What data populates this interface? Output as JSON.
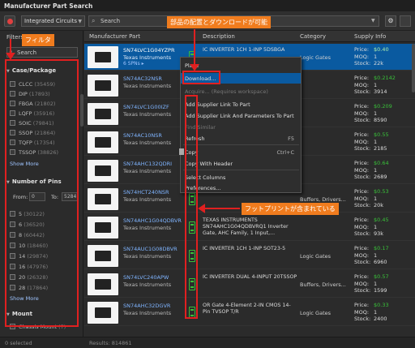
{
  "window": {
    "title": "Manufacturer Part Search"
  },
  "toolbar": {
    "category": "Integrated Circuits",
    "search_placeholder": "Search"
  },
  "filters": {
    "label": "Filters",
    "search_placeholder": "Search",
    "groups": [
      {
        "title": "Case/Package",
        "items": [
          {
            "name": "CLCC",
            "count": "(35459)"
          },
          {
            "name": "DIP",
            "count": "(17893)"
          },
          {
            "name": "FBGA",
            "count": "(21802)"
          },
          {
            "name": "LQFP",
            "count": "(35916)"
          },
          {
            "name": "SOIC",
            "count": "(79841)"
          },
          {
            "name": "SSOP",
            "count": "(21864)"
          },
          {
            "name": "TQFP",
            "count": "(17354)"
          },
          {
            "name": "TSSOP",
            "count": "(38826)"
          }
        ],
        "show_more": "Show More"
      },
      {
        "title": "Number of Pins",
        "from_label": "From:",
        "from_value": "0",
        "to_label": "To:",
        "to_value": "5284",
        "items": [
          {
            "name": "5",
            "count": "(30122)"
          },
          {
            "name": "6",
            "count": "(36520)"
          },
          {
            "name": "8",
            "count": "(60442)"
          },
          {
            "name": "10",
            "count": "(18460)"
          },
          {
            "name": "14",
            "count": "(29874)"
          },
          {
            "name": "16",
            "count": "(47976)"
          },
          {
            "name": "20",
            "count": "(26328)"
          },
          {
            "name": "28",
            "count": "(17864)"
          }
        ],
        "show_more": "Show More"
      },
      {
        "title": "Mount",
        "items": [
          {
            "name": "Chassis Mount",
            "count": "(7)"
          }
        ]
      }
    ]
  },
  "columns": [
    "Manufacturer Part",
    "Description",
    "Category",
    "Supply Info"
  ],
  "rows": [
    {
      "part": "SN74LVC1G04YZPR",
      "mfr": "Texas Instruments",
      "extra": "6 SPNs ▸",
      "desc": "IC INVERTER 1CH 1-INP 5DSBGA",
      "cat": "Logic Gates",
      "price": "$0.40",
      "moq": "1",
      "stock": "22k"
    },
    {
      "part": "SN74AC32NSR",
      "mfr": "Texas Instruments",
      "extra": "",
      "desc": "",
      "cat": "",
      "price": "$0.2142",
      "moq": "1",
      "stock": "3914"
    },
    {
      "part": "SN74LVC1G00IZF",
      "mfr": "Texas Instruments",
      "extra": "",
      "desc": "",
      "cat": "",
      "price": "$0.209",
      "moq": "1",
      "stock": "8590"
    },
    {
      "part": "SN74AC10NSR",
      "mfr": "Texas Instruments",
      "extra": "",
      "desc": "",
      "cat": "",
      "price": "$0.55",
      "moq": "1",
      "stock": "2185"
    },
    {
      "part": "SN74AHC132QDRI",
      "mfr": "Texas Instruments",
      "extra": "",
      "desc": "",
      "cat": "",
      "price": "$0.64",
      "moq": "1",
      "stock": "2689"
    },
    {
      "part": "SN74HCT240NSR",
      "mfr": "Texas Instruments",
      "extra": "",
      "desc": "",
      "cat": "Buffers, Drivers...",
      "price": "$0.53",
      "moq": "1",
      "stock": "20k"
    },
    {
      "part": "SN74AHC1G04QDBVR",
      "mfr": "Texas Instruments",
      "extra": "",
      "desc": "TEXAS INSTRUMENTS SN74AHC1G04QDBVRQ1 Inverter Gate, AHC Family, 1 Input,...",
      "cat": "",
      "price": "$0.45",
      "moq": "1",
      "stock": "93k"
    },
    {
      "part": "SN74AUC1G08DBVR",
      "mfr": "Texas Instruments",
      "extra": "",
      "desc": "IC INVERTER 1CH 1-INP SOT23-5",
      "cat": "Logic Gates",
      "price": "$0.17",
      "moq": "1",
      "stock": "6960"
    },
    {
      "part": "SN74LVC240APW",
      "mfr": "Texas Instruments",
      "extra": "",
      "desc": "IC INVERTER DUAL 4-INPUT 20TSSOP",
      "cat": "Buffers, Drivers...",
      "price": "$0.57",
      "moq": "1",
      "stock": "1599"
    },
    {
      "part": "SN74AHC32DGVR",
      "mfr": "Texas Instruments",
      "extra": "",
      "desc": "OR Gate 4-Element 2-IN CMOS 14-Pin TVSOP T/R",
      "cat": "Logic Gates",
      "price": "$0.33",
      "moq": "1",
      "stock": "2400"
    }
  ],
  "supply_labels": {
    "price": "Price:",
    "moq": "MOQ:",
    "stock": "Stock:"
  },
  "context_menu": {
    "items": [
      "Place",
      "Download...",
      "Acquire... (Requires workspace)",
      "Add Supplier Link To Part",
      "Add Supplier Link And Parameters To Part",
      "Find Similar",
      "Refresh",
      "Copy",
      "Copy With Header",
      "Select Columns",
      "Preferences..."
    ],
    "refresh_shortcut": "F5",
    "copy_shortcut": "Ctrl+C"
  },
  "annotations": {
    "filter": "フィルタ",
    "top": "部品の配置とダウンロードが可能",
    "footprint": "フットプリントが含まれている"
  },
  "status": {
    "selected": "0 selected",
    "results": "Results: 814861"
  },
  "colors": {
    "accent": "#0a5aa0",
    "annotation": "#f07c1e",
    "highlight_box": "#e02020",
    "in_stock": "#39c039"
  }
}
